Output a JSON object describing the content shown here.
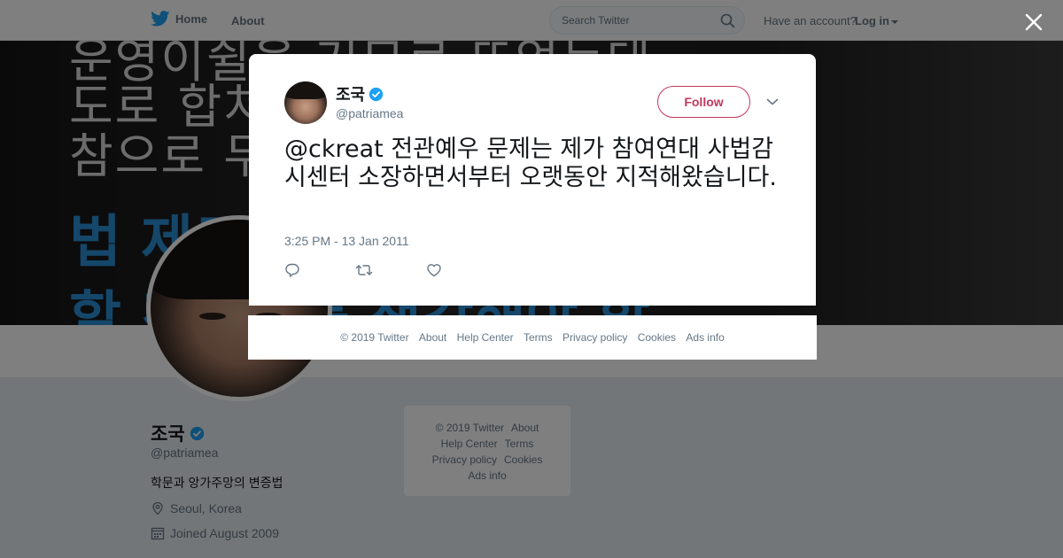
{
  "topbar": {
    "home_label": "Home",
    "about_label": "About",
    "search_placeholder": "Search Twitter",
    "have_account": "Have an account?",
    "login_label": "Log in"
  },
  "profile": {
    "name": "조국",
    "handle": "@patriamea",
    "bio": "학문과 앙가주망의 변증법",
    "location": "Seoul, Korea",
    "joined": "Joined August 2009"
  },
  "side_footer": {
    "copyright": "© 2019 Twitter",
    "about": "About",
    "help_center": "Help Center",
    "terms": "Terms",
    "privacy": "Privacy policy",
    "cookies": "Cookies",
    "ads_info": "Ads info"
  },
  "tweet": {
    "author_name": "조국",
    "author_handle": "@patriamea",
    "follow_label": "Follow",
    "mention": "@ckreat",
    "text": " 전관예우 문제는 제가 참여연대 사법감시센터 소장하면서부터 오랫동안 지적해왔습니다.",
    "timestamp": "3:25 PM - 13 Jan 2011"
  },
  "modal_footer": {
    "copyright": "© 2019 Twitter",
    "about": "About",
    "help_center": "Help Center",
    "terms": "Terms",
    "privacy": "Privacy policy",
    "cookies": "Cookies",
    "ads_info": "Ads info"
  },
  "colors": {
    "twitter_blue": "#1da1f2",
    "follow_red": "#c4375c",
    "verified": "#1da1f2",
    "muted": "#657786"
  },
  "icons": [
    "twitter-bird-icon",
    "search-icon",
    "close-icon",
    "verified-icon",
    "chevron-down-icon",
    "reply-icon",
    "retweet-icon",
    "like-icon",
    "location-icon",
    "calendar-icon"
  ]
}
